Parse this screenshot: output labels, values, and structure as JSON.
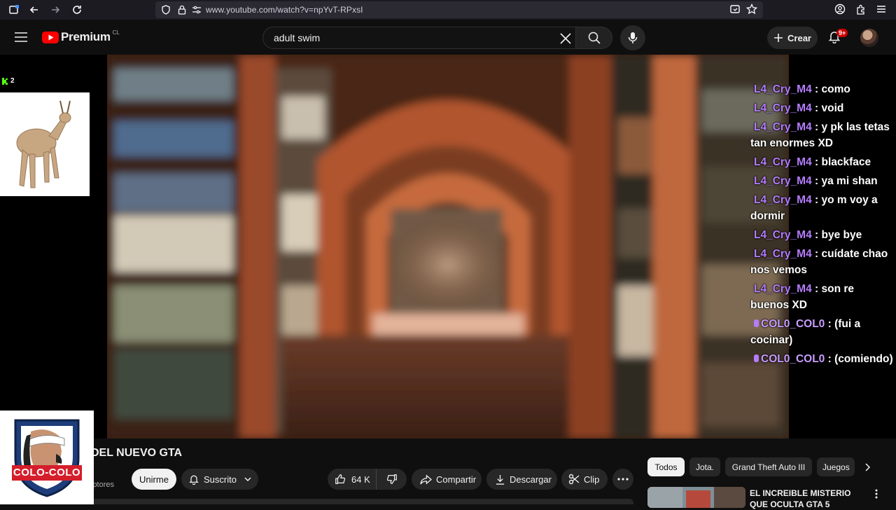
{
  "browser": {
    "url": "www.youtube.com/watch?v=npYvT-RPxsI"
  },
  "header": {
    "logo_text": "Premium",
    "logo_region": "CL",
    "search_value": "adult swim",
    "create_label": "Crear",
    "notification_count": "9+"
  },
  "overlay": {
    "k_count": "2",
    "logo_text": "COLO-COLO",
    "chat": [
      {
        "user": "L4_Cry_M4",
        "message": " : como",
        "mod": false
      },
      {
        "user": "L4_Cry_M4",
        "message": " : void",
        "mod": false
      },
      {
        "user": "L4_Cry_M4",
        "message": " : y pk las tetas tan enormes XD",
        "mod": false
      },
      {
        "user": "L4_Cry_M4",
        "message": " : blackface",
        "mod": false
      },
      {
        "user": "L4_Cry_M4",
        "message": " : ya mi shan",
        "mod": false
      },
      {
        "user": "L4_Cry_M4",
        "message": " : yo m voy a dormir",
        "mod": false
      },
      {
        "user": "L4_Cry_M4",
        "message": " : bye bye",
        "mod": false
      },
      {
        "user": "L4_Cry_M4",
        "message": " : cuídate chao nos vemos",
        "mod": false
      },
      {
        "user": "L4_Cry_M4",
        "message": " : son re buenos XD",
        "mod": false
      },
      {
        "user": "COL0_COL0",
        "message": " : (fui a cocinar)",
        "mod": true
      },
      {
        "user": "COL0_COL0",
        "message": " : (comiendo)",
        "mod": true
      }
    ]
  },
  "video": {
    "title": "DEL NUEVO GTA",
    "subscribers_partial": "iptores",
    "join_label": "Unirme",
    "subscribed_label": "Suscrito",
    "likes": "64 K",
    "share_label": "Compartir",
    "download_label": "Descargar",
    "clip_label": "Clip"
  },
  "sidebar": {
    "chips": [
      "Todos",
      "Jota.",
      "Grand Theft Auto III",
      "Juegos"
    ],
    "recommendation_title": "EL INCREIBLE MISTERIO QUE OCULTA GTA 5"
  }
}
